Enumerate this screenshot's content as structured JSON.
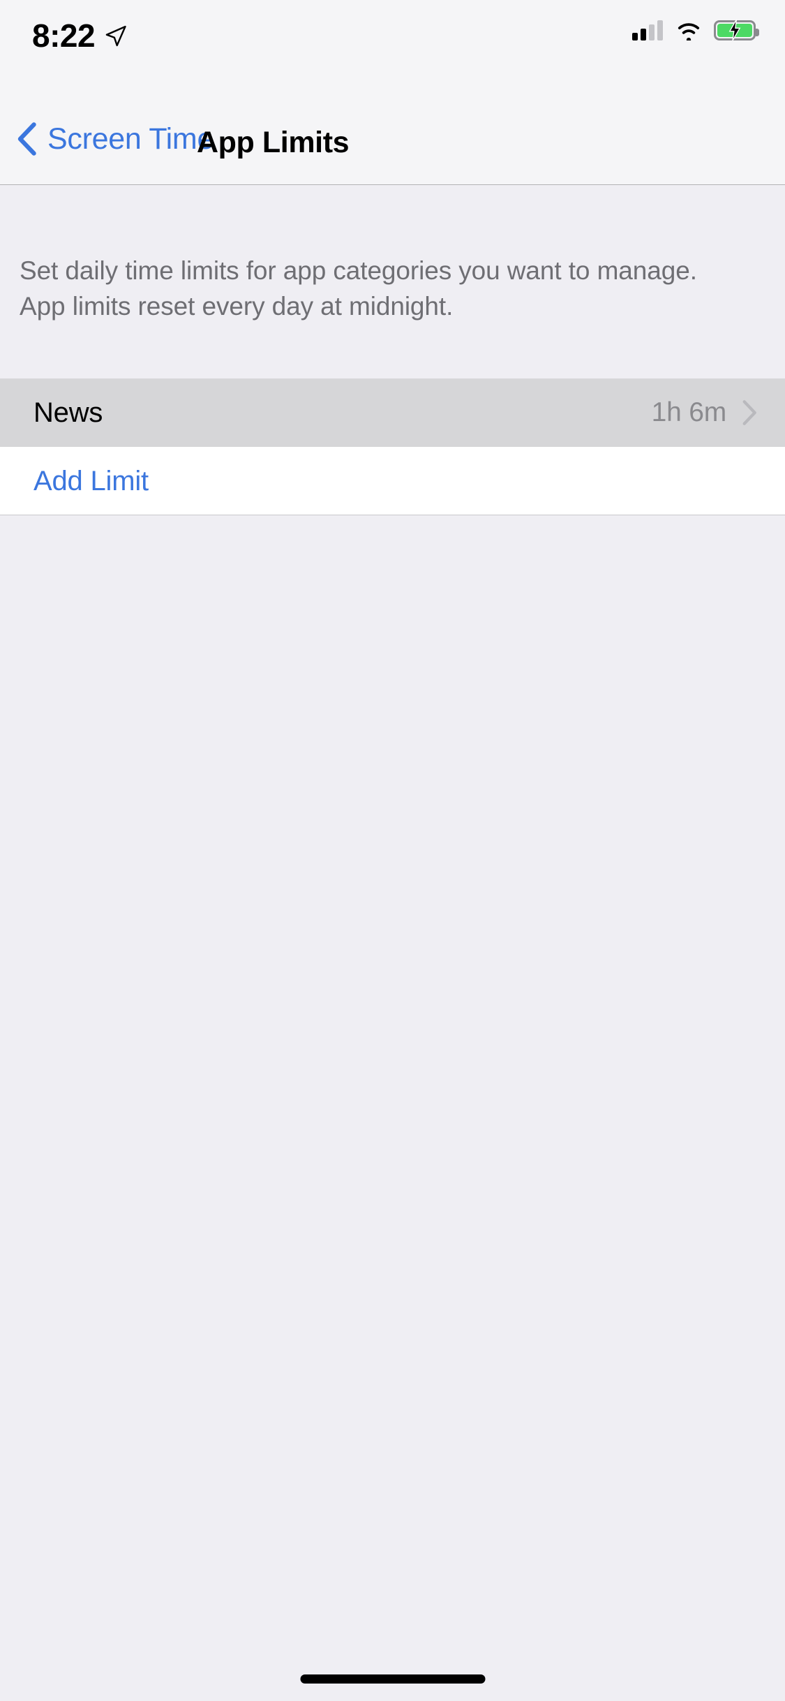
{
  "status_bar": {
    "time": "8:22",
    "location_icon": "location-arrow-icon",
    "signal_icon": "cellular-signal-icon",
    "signal_bars_filled": 2,
    "signal_bars_total": 4,
    "wifi_icon": "wifi-icon",
    "battery_icon": "battery-charging-icon",
    "battery_charging": true,
    "battery_color": "#4CD964"
  },
  "nav_bar": {
    "back_icon": "chevron-left-icon",
    "back_label": "Screen Time",
    "title": "App Limits",
    "accent_color": "#3B76DE"
  },
  "main": {
    "description": "Set daily time limits for app categories you want to manage.\nApp limits reset every day at midnight.",
    "limits": [
      {
        "name": "News",
        "value": "1h 6m",
        "chevron_icon": "chevron-right-icon",
        "highlighted": true
      }
    ],
    "add_limit_label": "Add Limit"
  },
  "home_indicator": "home-indicator-bar"
}
